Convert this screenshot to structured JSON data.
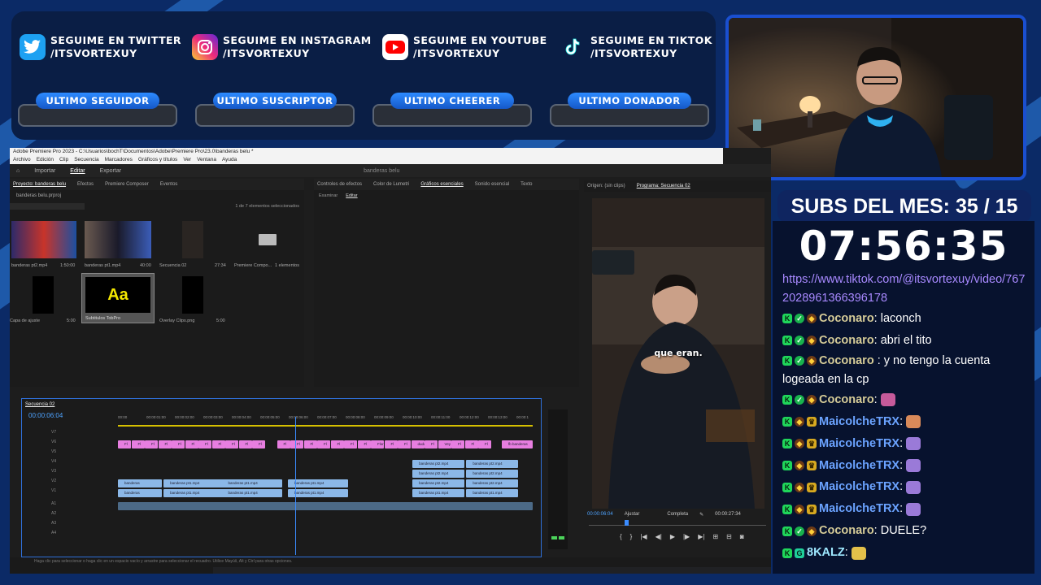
{
  "socials": [
    {
      "icon": "twitter-icon",
      "color": "#1da1f2",
      "line1": "SEGUIME EN TWITTER",
      "line2": "/ITSVORTEXUY"
    },
    {
      "icon": "instagram-icon",
      "color": "#d62976",
      "line1": "SEGUIME EN INSTAGRAM",
      "line2": "/ITSVORTEXUY"
    },
    {
      "icon": "youtube-icon",
      "color": "#ff0000",
      "line1": "SEGUIME EN YOUTUBE",
      "line2": "/ITSVORTEXUY"
    },
    {
      "icon": "tiktok-icon",
      "color": "#000000",
      "line1": "SEGUIME EN TIKTOK",
      "line2": "/ITSVORTEXUY"
    }
  ],
  "pills": [
    "ULTIMO SEGUIDOR",
    "ULTIMO SUSCRIPTOR",
    "ULTIMO CHEERER",
    "ULTIMO DONADOR"
  ],
  "subs": "SUBS DEL MES: 35 / 15",
  "timer": "07:56:35",
  "chat": {
    "link": "https://www.tiktok.com/@itsvortexuy/video/7672028961366396178",
    "messages": [
      {
        "user": "Coconaro",
        "text": " : laconch"
      },
      {
        "user": "Coconaro",
        "text": " : abri el tito"
      },
      {
        "user": "Coconaro",
        "text": " : y no tengo la cuenta logeada en la cp"
      },
      {
        "user": "Coconaro",
        "text": " : "
      },
      {
        "user": "MaicolcheTRX",
        "text": " : "
      },
      {
        "user": "MaicolcheTRX",
        "text": " : "
      },
      {
        "user": "MaicolcheTRX",
        "text": " : "
      },
      {
        "user": "MaicolcheTRX",
        "text": " : "
      },
      {
        "user": "MaicolcheTRX",
        "text": " : "
      },
      {
        "user": "Coconaro",
        "text": " : DUELE?"
      },
      {
        "user": "8KALZ",
        "text": " : "
      }
    ]
  },
  "premiere": {
    "title": "Adobe Premiere Pro 2023 - C:\\Usuarios\\bochT\\Documentos\\Adobe\\Premiere Pro\\23.0\\banderas belu *",
    "menu": [
      "Archivo",
      "Edición",
      "Clip",
      "Secuencia",
      "Marcadores",
      "Gráficos y títulos",
      "Ver",
      "Ventana",
      "Ayuda"
    ],
    "workspace": [
      "Importar",
      "Editar",
      "Exportar"
    ],
    "project_name": "banderas belu",
    "project_tabs": [
      "Proyecto: banderas belu",
      "Efectos",
      "Premiere Composer",
      "Eventos"
    ],
    "project_file": "banderas belu.prproj",
    "selection": "1 de 7 elementos seleccionados",
    "bins": [
      {
        "name": "banderas pt2.mp4",
        "dur": "1:50:00"
      },
      {
        "name": "banderas pt1.mp4",
        "dur": "40:00"
      },
      {
        "name": "Secuencia 02",
        "dur": "27:34"
      },
      {
        "name": "Premiere Compo...",
        "dur": "1 elementos"
      },
      {
        "name": "Capa de ajuste",
        "dur": "5:00"
      },
      {
        "name": "Subtitulos TobPro",
        "dur": ""
      },
      {
        "name": "Overlay Clips.png",
        "dur": "5:00"
      }
    ],
    "effect_tabs": [
      "Controles de efectos",
      "Color de Lumetri",
      "Gráficos esenciales",
      "Sonido esencial",
      "Texto"
    ],
    "effect_subtabs": [
      "Examinar",
      "Editar"
    ],
    "source_tab": "Origen: (sin clips)",
    "program_tab": "Programa: Secuencia 02",
    "sequence_tab": "Secuencia 02",
    "timecode": "00:00:06:04",
    "ruler": [
      "00:00",
      "00:00:01:00",
      "00:00:02:00",
      "00:00:03:00",
      "00:00:04:00",
      "00:00:05:00",
      "00:00:06:00",
      "00:00:07:00",
      "00:00:08:00",
      "00:00:09:00",
      "00:00:10:00",
      "00:00:11:00",
      "00:00:12:00",
      "00:00:13:00",
      "00:00:1"
    ],
    "video_tracks": [
      "V7",
      "V6",
      "V5",
      "V4",
      "V3",
      "V2",
      "V1"
    ],
    "audio_tracks": [
      "A1",
      "A2",
      "A3",
      "A4"
    ],
    "program_time": "00:00:06:04",
    "fit": "Ajustar",
    "quality": "Completa",
    "duration": "00:00:27:34",
    "caption": "que eran.",
    "status": "Haga clic para seleccionar o haga clic en un espacio vacío y arrastre para seleccionar el recuadro. Utilice Mayúš, Alt y Ctrl para otras opciones."
  },
  "clips_v": [
    {
      "label": "banderas",
      "track": 6,
      "start": 0.0
    },
    {
      "label": "banderas pt1.mp4",
      "track": 6,
      "start": 0.11
    },
    {
      "label": "banderas pt1.mp4",
      "track": 6,
      "start": 0.25
    },
    {
      "label": "banderas pt1.mp4",
      "track": 6,
      "start": 0.41
    },
    {
      "label": "banderas pt1.mp4",
      "track": 6,
      "start": 0.71
    },
    {
      "label": "banderas pt1.mp4",
      "track": 6,
      "start": 0.84
    },
    {
      "label": "banderas",
      "track": 5,
      "start": 0.0
    },
    {
      "label": "banderas pt1.mp4",
      "track": 5,
      "start": 0.11
    },
    {
      "label": "banderas pt1.mp4",
      "track": 5,
      "start": 0.25
    },
    {
      "label": "banderas pt1.mp4",
      "track": 5,
      "start": 0.41
    },
    {
      "label": "banderas pt2.mp4",
      "track": 5,
      "start": 0.71
    },
    {
      "label": "banderas pt2.mp4",
      "track": 5,
      "start": 0.84
    },
    {
      "label": "banderas pt2.mp4",
      "track": 4,
      "start": 0.71
    },
    {
      "label": "banderas pt2.mp4",
      "track": 4,
      "start": 0.84
    },
    {
      "label": "banderas pt2.mp4",
      "track": 3,
      "start": 0.71
    },
    {
      "label": "banderas pt2.mp4",
      "track": 3,
      "start": 0.84
    }
  ],
  "pink_labels": [
    "Fl",
    "Fl",
    "Fl",
    "Fl",
    "Fl",
    "Fl",
    "Fl",
    "Fl",
    "Fl",
    "Fl",
    "Fl",
    "Fl",
    "Fl",
    "Fl",
    "Fl",
    "Fl",
    "Fl",
    "Fl",
    "Flori",
    "Fl",
    "Fl",
    "dudam",
    "Fl",
    "Vey",
    "Fl",
    "Fl",
    "Fl",
    "fb banderas"
  ]
}
